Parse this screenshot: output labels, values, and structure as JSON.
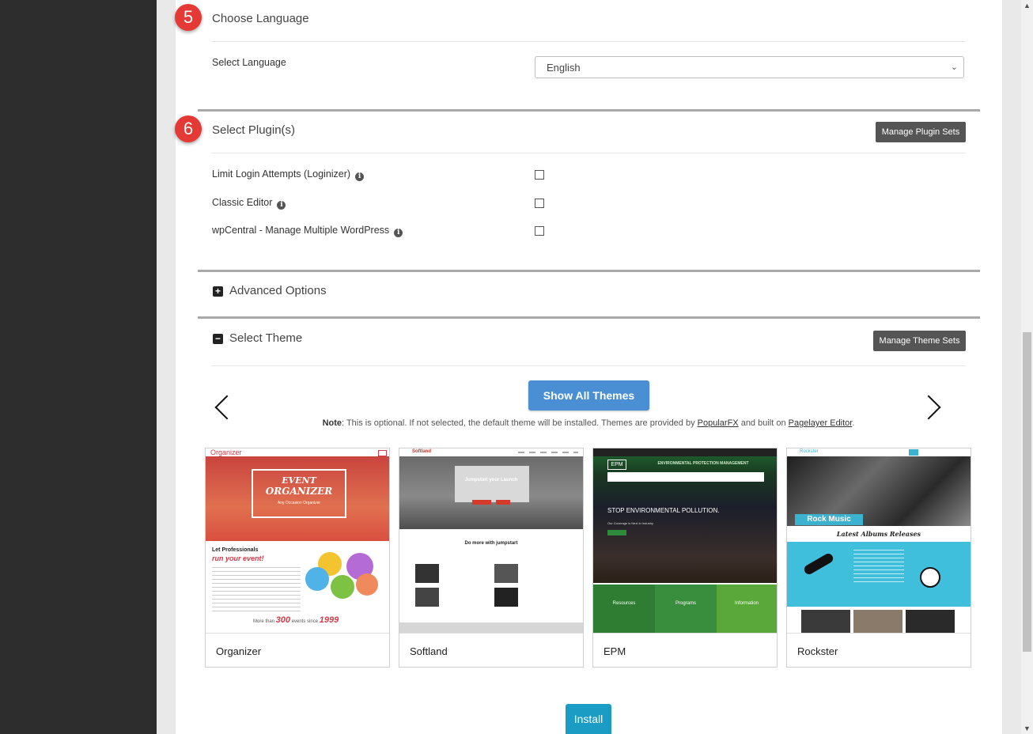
{
  "language_section": {
    "step": "5",
    "title": "Choose Language",
    "field_label": "Select Language",
    "selected_language": "English"
  },
  "plugins_section": {
    "step": "6",
    "title": "Select Plugin(s)",
    "manage_button": "Manage Plugin Sets",
    "plugins": [
      {
        "label": "Limit Login Attempts (Loginizer)",
        "checked": false
      },
      {
        "label": "Classic Editor",
        "checked": false
      },
      {
        "label": "wpCentral - Manage Multiple WordPress",
        "checked": false
      }
    ]
  },
  "advanced_section": {
    "toggle": "+",
    "title": "Advanced Options"
  },
  "theme_section": {
    "toggle": "−",
    "title": "Select Theme",
    "manage_button": "Manage Theme Sets",
    "show_all_button": "Show All Themes",
    "note_label": "Note",
    "note_text_1": ": This is optional. If not selected, the default theme will be installed. Themes are provided by ",
    "note_link_1": "PopularFX",
    "note_text_2": " and built on ",
    "note_link_2": "Pagelayer Editor",
    "note_text_3": ".",
    "themes": [
      {
        "name": "Organizer",
        "brand": "Organizer",
        "hero_line1": "EVENT",
        "hero_line2": "ORGANIZER",
        "hero_sub": "Any Occasion Organizer",
        "tag1": "Let Professionals",
        "tag2": "run your event!",
        "footer_1": "More than ",
        "footer_num": "300",
        "footer_2": " events since ",
        "footer_year": "1999"
      },
      {
        "name": "Softland",
        "brand": "Softland",
        "hero": "Jumpstart your Launch",
        "section": "Do more with jumpstart"
      },
      {
        "name": "EPM",
        "brand": "EPM",
        "header": "ENVIRONMENTAL PROTECTION MANAGEMENT",
        "hero": "STOP ENVIRONMENTAL POLLUTION.",
        "hero_sub": "Our Coverage is Next in Industry",
        "cols": [
          "Resources",
          "Programs",
          "Information"
        ]
      },
      {
        "name": "Rockster",
        "brand": "Rockster",
        "hero": "Rock Music",
        "sub": "Latest Albums Releases"
      }
    ]
  },
  "install_button": "Install",
  "colors": {
    "badge": "#e53935",
    "primary": "#4a8fd4",
    "install": "#1a9cc4",
    "dark_button": "#555555"
  }
}
